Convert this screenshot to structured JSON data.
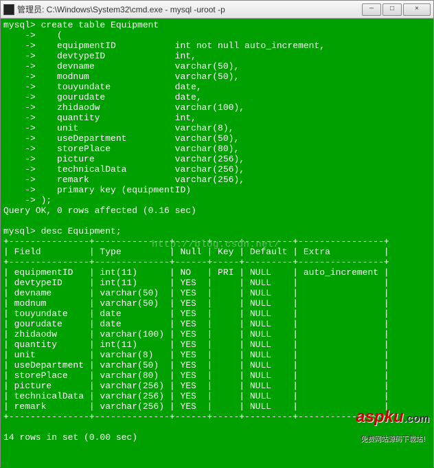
{
  "window": {
    "title": "管理员: C:\\Windows\\System32\\cmd.exe - mysql  -uroot -p",
    "min_label": "─",
    "max_label": "□",
    "close_label": "×"
  },
  "create_block": {
    "prompt": "mysql> ",
    "cont": "    -> ",
    "cmd": "create table Equipment",
    "open": "   (",
    "rows": [
      [
        "equipmentID",
        "int not null auto_increment,"
      ],
      [
        "devtypeID",
        "int,"
      ],
      [
        "devname",
        "varchar(50),"
      ],
      [
        "modnum",
        "varchar(50),"
      ],
      [
        "touyundate",
        "date,"
      ],
      [
        "gourudate",
        "date,"
      ],
      [
        "zhidaodw",
        "varchar(100),"
      ],
      [
        "quantity",
        "int,"
      ],
      [
        "unit",
        "varchar(8),"
      ],
      [
        "useDepartment",
        "varchar(50),"
      ],
      [
        "storePlace",
        "varchar(80),"
      ],
      [
        "picture",
        "varchar(256),"
      ],
      [
        "technicalData",
        "varchar(256),"
      ],
      [
        "remark",
        "varchar(256),"
      ]
    ],
    "pk": "   primary key (equipmentID)",
    "close": ");",
    "result": "Query OK, 0 rows affected (0.16 sec)"
  },
  "desc_block": {
    "cmd": "desc Equipment;",
    "headers": [
      "Field",
      "Type",
      "Null",
      "Key",
      "Default",
      "Extra"
    ],
    "rows": [
      [
        "equipmentID",
        "int(11)",
        "NO",
        "PRI",
        "NULL",
        "auto_increment"
      ],
      [
        "devtypeID",
        "int(11)",
        "YES",
        "",
        "NULL",
        ""
      ],
      [
        "devname",
        "varchar(50)",
        "YES",
        "",
        "NULL",
        ""
      ],
      [
        "modnum",
        "varchar(50)",
        "YES",
        "",
        "NULL",
        ""
      ],
      [
        "touyundate",
        "date",
        "YES",
        "",
        "NULL",
        ""
      ],
      [
        "gourudate",
        "date",
        "YES",
        "",
        "NULL",
        ""
      ],
      [
        "zhidaodw",
        "varchar(100)",
        "YES",
        "",
        "NULL",
        ""
      ],
      [
        "quantity",
        "int(11)",
        "YES",
        "",
        "NULL",
        ""
      ],
      [
        "unit",
        "varchar(8)",
        "YES",
        "",
        "NULL",
        ""
      ],
      [
        "useDepartment",
        "varchar(50)",
        "YES",
        "",
        "NULL",
        ""
      ],
      [
        "storePlace",
        "varchar(80)",
        "YES",
        "",
        "NULL",
        ""
      ],
      [
        "picture",
        "varchar(256)",
        "YES",
        "",
        "NULL",
        ""
      ],
      [
        "technicalData",
        "varchar(256)",
        "YES",
        "",
        "NULL",
        ""
      ],
      [
        "remark",
        "varchar(256)",
        "YES",
        "",
        "NULL",
        ""
      ]
    ],
    "footer": "14 rows in set (0.00 sec)"
  },
  "watermark": {
    "url": "http://blog.csdn.net/",
    "logo_main": "aspku",
    "logo_dotcom": ".com",
    "logo_sub": "免费网站源码下载站！"
  },
  "chart_data": {
    "type": "table",
    "title": "desc Equipment",
    "columns": [
      "Field",
      "Type",
      "Null",
      "Key",
      "Default",
      "Extra"
    ],
    "rows": [
      [
        "equipmentID",
        "int(11)",
        "NO",
        "PRI",
        "NULL",
        "auto_increment"
      ],
      [
        "devtypeID",
        "int(11)",
        "YES",
        "",
        "NULL",
        ""
      ],
      [
        "devname",
        "varchar(50)",
        "YES",
        "",
        "NULL",
        ""
      ],
      [
        "modnum",
        "varchar(50)",
        "YES",
        "",
        "NULL",
        ""
      ],
      [
        "touyundate",
        "date",
        "YES",
        "",
        "NULL",
        ""
      ],
      [
        "gourudate",
        "date",
        "YES",
        "",
        "NULL",
        ""
      ],
      [
        "zhidaodw",
        "varchar(100)",
        "YES",
        "",
        "NULL",
        ""
      ],
      [
        "quantity",
        "int(11)",
        "YES",
        "",
        "NULL",
        ""
      ],
      [
        "unit",
        "varchar(8)",
        "YES",
        "",
        "NULL",
        ""
      ],
      [
        "useDepartment",
        "varchar(50)",
        "YES",
        "",
        "NULL",
        ""
      ],
      [
        "storePlace",
        "varchar(80)",
        "YES",
        "",
        "NULL",
        ""
      ],
      [
        "picture",
        "varchar(256)",
        "YES",
        "",
        "NULL",
        ""
      ],
      [
        "technicalData",
        "varchar(256)",
        "YES",
        "",
        "NULL",
        ""
      ],
      [
        "remark",
        "varchar(256)",
        "YES",
        "",
        "NULL",
        ""
      ]
    ]
  }
}
